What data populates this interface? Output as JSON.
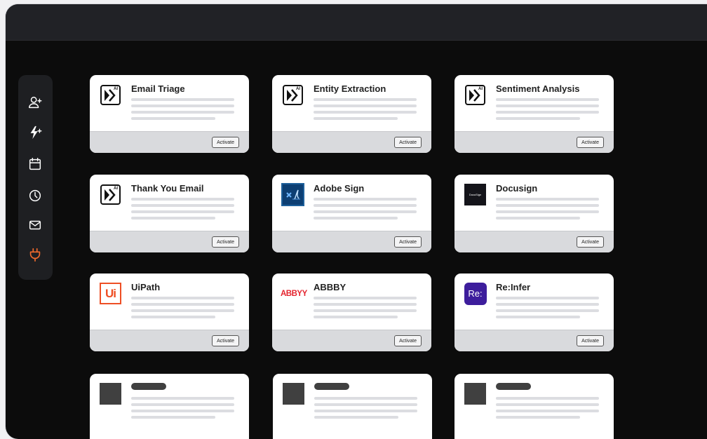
{
  "sidebar": {
    "items": [
      {
        "icon": "add-user-icon"
      },
      {
        "icon": "add-automation-icon"
      },
      {
        "icon": "calendar-icon"
      },
      {
        "icon": "clock-icon"
      },
      {
        "icon": "mail-icon"
      },
      {
        "icon": "plug-icon",
        "active": true,
        "color": "#f26b2d"
      }
    ]
  },
  "integrations": {
    "activate_label": "Activate",
    "cards": [
      {
        "title": "Email Triage",
        "logo": "ai-logo"
      },
      {
        "title": "Entity Extraction",
        "logo": "ai-logo"
      },
      {
        "title": "Sentiment Analysis",
        "logo": "ai-logo"
      },
      {
        "title": "Thank You Email",
        "logo": "ai-logo"
      },
      {
        "title": "Adobe Sign",
        "logo": "adobe-sign-logo"
      },
      {
        "title": "Docusign",
        "logo": "docusign-logo",
        "logo_text": "DocuSign"
      },
      {
        "title": "UiPath",
        "logo": "uipath-logo",
        "logo_text": "Ui"
      },
      {
        "title": "ABBBY",
        "logo": "abbyy-logo",
        "logo_text": "ABBYY"
      },
      {
        "title": "Re:Infer",
        "logo": "reinfer-logo",
        "logo_text": "Re:"
      }
    ]
  },
  "colors": {
    "background": "#0c0c0c",
    "card": "#ffffff",
    "card_footer": "#d9dadd",
    "accent": "#f26b2d",
    "abbyy_red": "#e4242e",
    "uipath_orange": "#ee4f25",
    "reinfer_purple": "#3d1d9c"
  }
}
